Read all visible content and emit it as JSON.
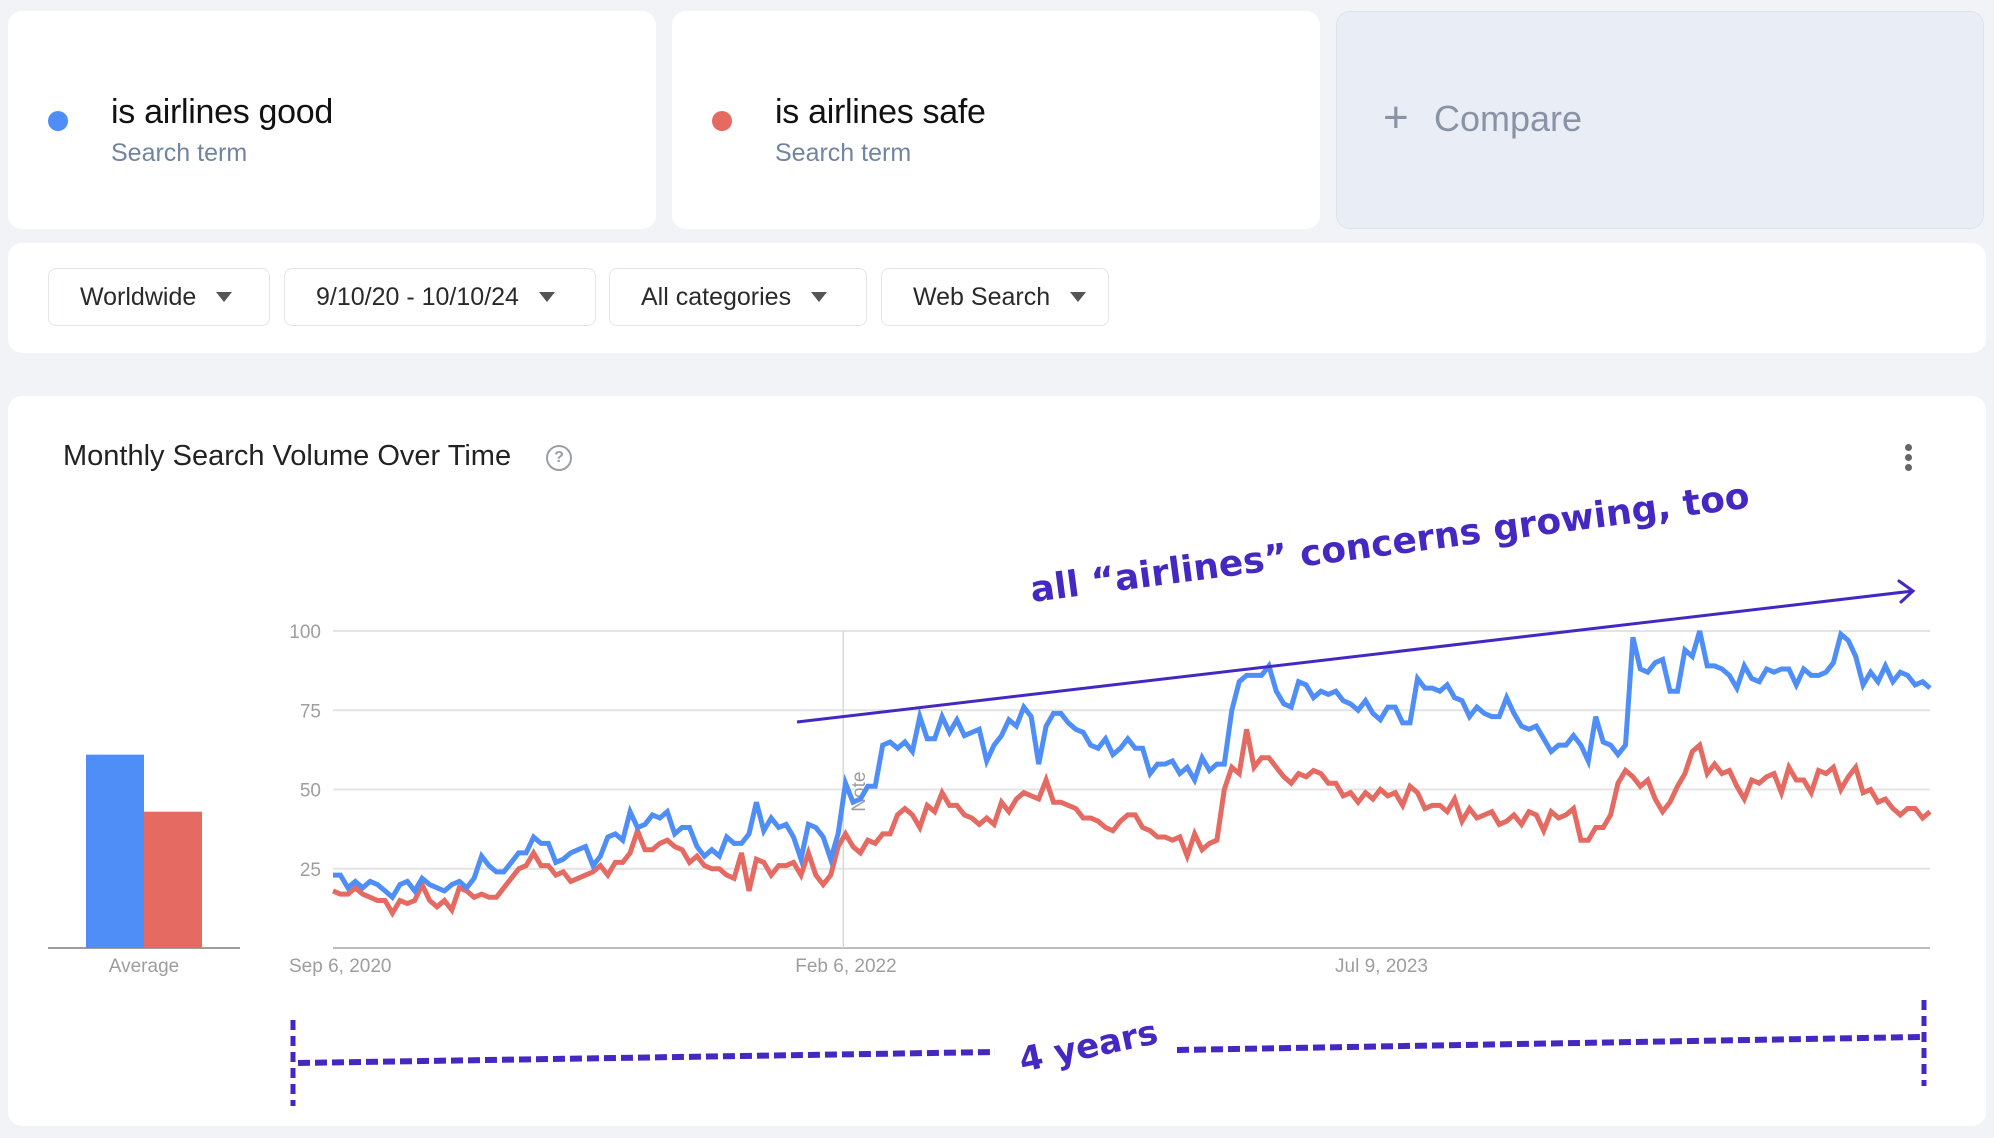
{
  "terms": [
    {
      "name": "is airlines good",
      "subtitle": "Search term",
      "color": "#4f8ef7"
    },
    {
      "name": "is airlines safe",
      "subtitle": "Search term",
      "color": "#e46a62"
    }
  ],
  "compare": {
    "icon": "plus-icon",
    "label": "Compare"
  },
  "filters": [
    {
      "label": "Worldwide"
    },
    {
      "label": "9/10/20 - 10/10/24"
    },
    {
      "label": "All categories"
    },
    {
      "label": "Web Search"
    }
  ],
  "panel": {
    "title": "Monthly Search Volume Over Time",
    "help_icon": "help-circle-icon",
    "menu_icon": "more-vert-icon"
  },
  "annotations": {
    "trend_text": "all “airlines” concerns growing, too",
    "span_text": "4 years",
    "note_label": "Note",
    "accent_color": "#4527c2"
  },
  "chart_data": {
    "type": "line",
    "title": "Monthly Search Volume Over Time",
    "xlabel": "",
    "ylabel": "",
    "ylim": [
      0,
      100
    ],
    "yticks": [
      25,
      50,
      75,
      100
    ],
    "xticks": [
      "Sep 6, 2020",
      "Feb 6, 2022",
      "Jul 9, 2023"
    ],
    "x_range": [
      "Sep 6, 2020",
      "Oct 6, 2024"
    ],
    "grid": true,
    "note_marker_at": "Feb 6, 2022",
    "series": [
      {
        "name": "is airlines good",
        "color": "#4f8ef7",
        "values": [
          23,
          23,
          19,
          21,
          19,
          21,
          20,
          18,
          16,
          20,
          21,
          18,
          22,
          20,
          19,
          18,
          20,
          21,
          19,
          22,
          29,
          26,
          24,
          24,
          27,
          30,
          30,
          35,
          33,
          33,
          27,
          28,
          30,
          31,
          32,
          26,
          29,
          35,
          36,
          34,
          43,
          38,
          39,
          42,
          41,
          43,
          36,
          38,
          38,
          32,
          29,
          31,
          29,
          35,
          33,
          33,
          36,
          46,
          37,
          41,
          38,
          39,
          35,
          28,
          39,
          38,
          35,
          28,
          36,
          52,
          46,
          47,
          51,
          51,
          64,
          65,
          63,
          65,
          62,
          73,
          66,
          66,
          73,
          68,
          72,
          67,
          68,
          69,
          59,
          64,
          67,
          72,
          70,
          76,
          73,
          58,
          70,
          74,
          74,
          71,
          69,
          68,
          64,
          63,
          66,
          61,
          63,
          66,
          63,
          63,
          55,
          58,
          58,
          59,
          55,
          57,
          53,
          60,
          56,
          58,
          58,
          75,
          84,
          86,
          86,
          86,
          89,
          81,
          77,
          76,
          84,
          83,
          79,
          81,
          80,
          81,
          78,
          77,
          75,
          78,
          74,
          72,
          76,
          76,
          71,
          71,
          85,
          82,
          82,
          81,
          83,
          79,
          78,
          73,
          76,
          74,
          73,
          73,
          79,
          74,
          70,
          69,
          70,
          66,
          62,
          64,
          64,
          67,
          64,
          59,
          73,
          65,
          64,
          61,
          64,
          98,
          88,
          87,
          90,
          91,
          81,
          81,
          94,
          92,
          100,
          89,
          89,
          88,
          86,
          82,
          89,
          85,
          84,
          88,
          87,
          88,
          88,
          83,
          88,
          86,
          86,
          87,
          90,
          99,
          97,
          92,
          83,
          87,
          84,
          89,
          84,
          87,
          86,
          83,
          84,
          82
        ],
        "average": 61
      },
      {
        "name": "is airlines safe",
        "color": "#e46a62",
        "values": [
          18,
          17,
          17,
          19,
          17,
          16,
          15,
          15,
          11,
          15,
          14,
          15,
          20,
          15,
          13,
          15,
          12,
          19,
          18,
          16,
          17,
          16,
          16,
          19,
          22,
          25,
          26,
          30,
          26,
          26,
          23,
          24,
          21,
          22,
          23,
          24,
          26,
          23,
          27,
          27,
          30,
          37,
          31,
          31,
          33,
          34,
          32,
          31,
          27,
          29,
          26,
          25,
          25,
          23,
          22,
          30,
          18,
          28,
          27,
          23,
          26,
          26,
          27,
          23,
          30,
          23,
          20,
          23,
          32,
          36,
          32,
          30,
          34,
          33,
          36,
          36,
          42,
          44,
          42,
          38,
          45,
          43,
          49,
          45,
          45,
          42,
          41,
          39,
          41,
          39,
          46,
          43,
          47,
          49,
          48,
          47,
          53,
          46,
          46,
          45,
          44,
          41,
          41,
          40,
          38,
          37,
          40,
          42,
          42,
          38,
          37,
          35,
          35,
          34,
          35,
          29,
          36,
          31,
          33,
          34,
          50,
          57,
          55,
          69,
          57,
          60,
          60,
          57,
          54,
          52,
          55,
          54,
          56,
          55,
          52,
          52,
          48,
          49,
          46,
          49,
          47,
          50,
          48,
          49,
          45,
          51,
          49,
          44,
          45,
          45,
          43,
          47,
          40,
          44,
          41,
          42,
          43,
          39,
          40,
          42,
          39,
          43,
          42,
          37,
          43,
          41,
          42,
          44,
          34,
          34,
          38,
          38,
          42,
          52,
          56,
          54,
          51,
          53,
          47,
          43,
          46,
          51,
          55,
          62,
          64,
          55,
          58,
          55,
          56,
          51,
          47,
          53,
          52,
          54,
          55,
          49,
          57,
          53,
          53,
          49,
          56,
          55,
          57,
          50,
          54,
          57,
          49,
          50,
          46,
          47,
          44,
          42,
          44,
          44,
          41,
          43
        ],
        "average": 43
      }
    ],
    "average_bars": {
      "label": "Average",
      "categories": [
        "is airlines good",
        "is airlines safe"
      ],
      "values": [
        61,
        43
      ]
    }
  }
}
